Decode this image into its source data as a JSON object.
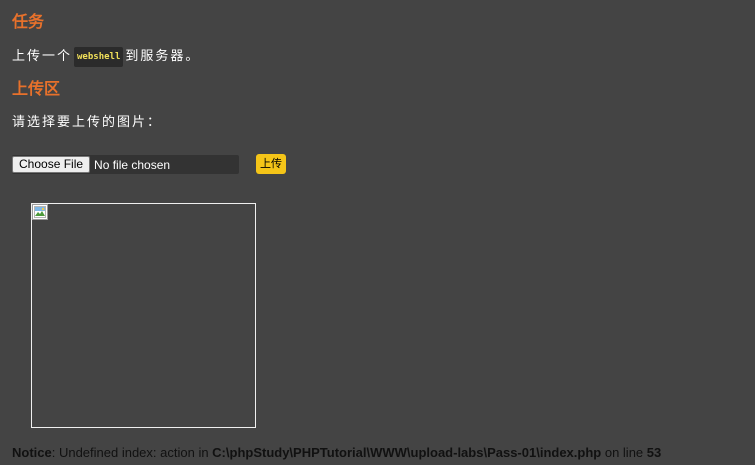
{
  "task": {
    "heading": "任务",
    "desc_before": "上传一个",
    "code": "webshell",
    "desc_after": "到服务器。"
  },
  "upload": {
    "heading": "上传区",
    "prompt": "请选择要上传的图片：",
    "choose_label": "Choose File",
    "file_status": "No file chosen",
    "submit_label": "上传"
  },
  "notice": {
    "label": "Notice",
    "message": ": Undefined index: action in ",
    "path": "C:\\phpStudy\\PHPTutorial\\WWW\\upload-labs\\Pass-01\\index.php",
    "line_text": " on line ",
    "line": "53"
  },
  "colors": {
    "background": "#444444",
    "heading": "#e8712b",
    "submit": "#f5c518",
    "code": "#f1e05a"
  },
  "icons": {
    "preview": "broken-image-icon"
  }
}
